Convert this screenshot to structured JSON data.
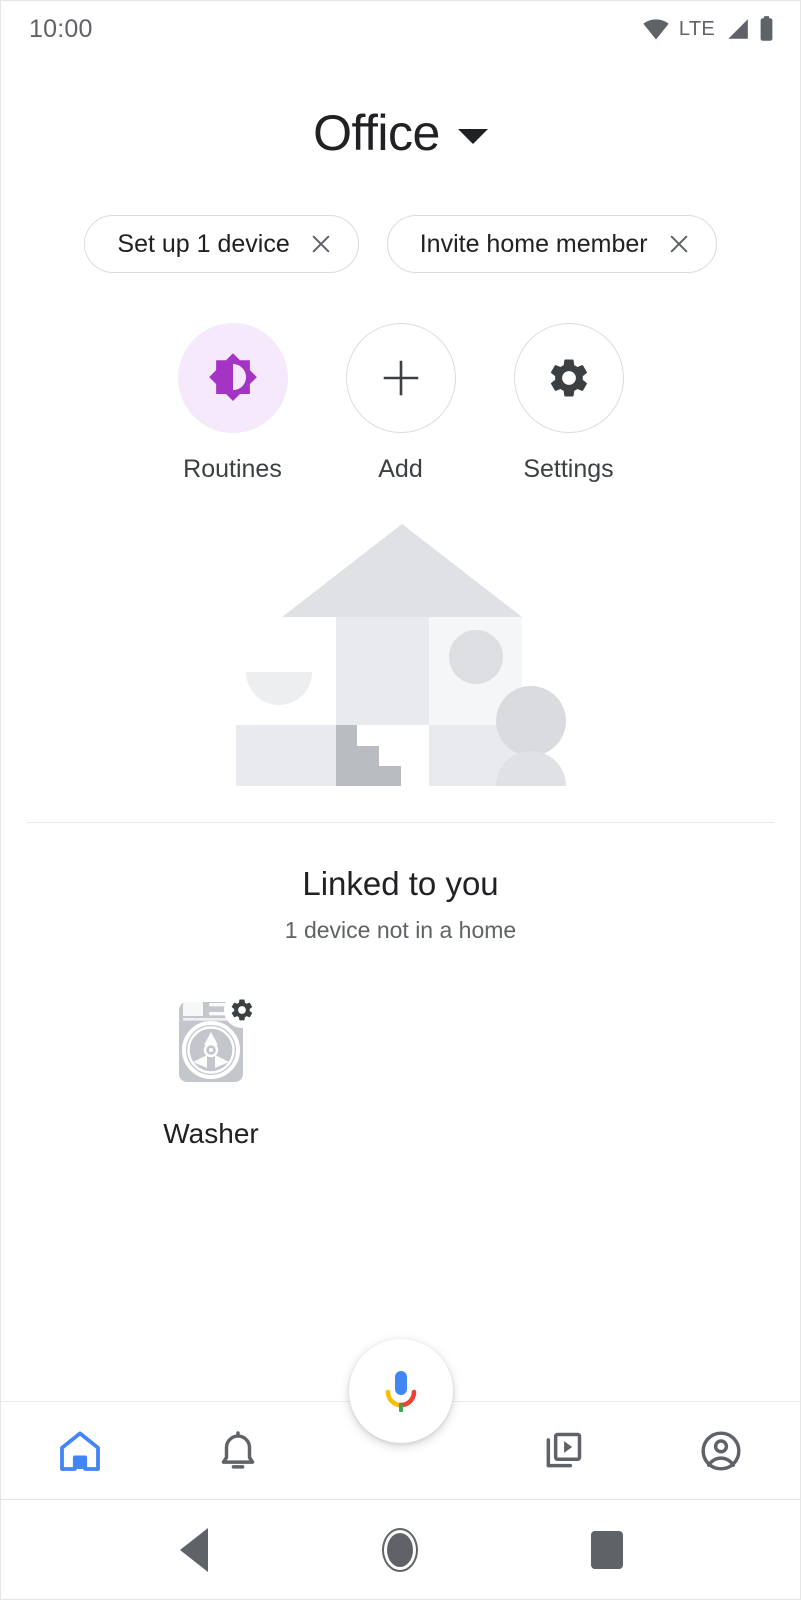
{
  "status_bar": {
    "time": "10:00",
    "network_label": "LTE",
    "icons": [
      "wifi-icon",
      "signal-icon",
      "battery-icon"
    ]
  },
  "header": {
    "home_name": "Office",
    "dropdown_icon": "chevron-down-icon"
  },
  "chips": [
    {
      "label": "Set up 1 device",
      "close_icon": "close-icon"
    },
    {
      "label": "Invite home member",
      "close_icon": "close-icon"
    }
  ],
  "actions": [
    {
      "label": "Routines",
      "icon": "brightness-star-icon",
      "style": "tinted",
      "accent": "#A435C4"
    },
    {
      "label": "Add",
      "icon": "plus-icon",
      "style": "outlined",
      "accent": "#3c4043"
    },
    {
      "label": "Settings",
      "icon": "gear-icon",
      "style": "outlined",
      "accent": "#3c4043"
    }
  ],
  "illustration": {
    "name": "empty-home-illustration",
    "colors": {
      "roof": "#dfe1e5",
      "wall_left": "#e8eaed",
      "wall_right": "#f5f6f7",
      "block": "#e8eaed",
      "stairs": "#b9bcc1",
      "circle": "#dcdee1",
      "person": "#d9dbde"
    }
  },
  "linked_section": {
    "title": "Linked to you",
    "subtitle": "1 device not in a home",
    "devices": [
      {
        "label": "Washer",
        "icon": "washer-icon",
        "badge_icon": "gear-icon"
      }
    ]
  },
  "assistant": {
    "icon": "google-assistant-mic-icon",
    "colors": {
      "blue": "#4285F4",
      "red": "#EA4335",
      "yellow": "#FBBC05",
      "green": "#34A853"
    }
  },
  "bottom_nav": {
    "active_color": "#4285F4",
    "inactive_color": "#5f6368",
    "items": [
      {
        "name": "home",
        "icon": "home-icon",
        "active": true
      },
      {
        "name": "notifications",
        "icon": "bell-icon",
        "active": false
      },
      {
        "name": "media",
        "icon": "media-play-icon",
        "active": false
      },
      {
        "name": "account",
        "icon": "account-circle-icon",
        "active": false
      }
    ]
  },
  "system_nav": {
    "back": "back-triangle-icon",
    "home": "home-circle-icon",
    "recents": "recents-square-icon"
  }
}
